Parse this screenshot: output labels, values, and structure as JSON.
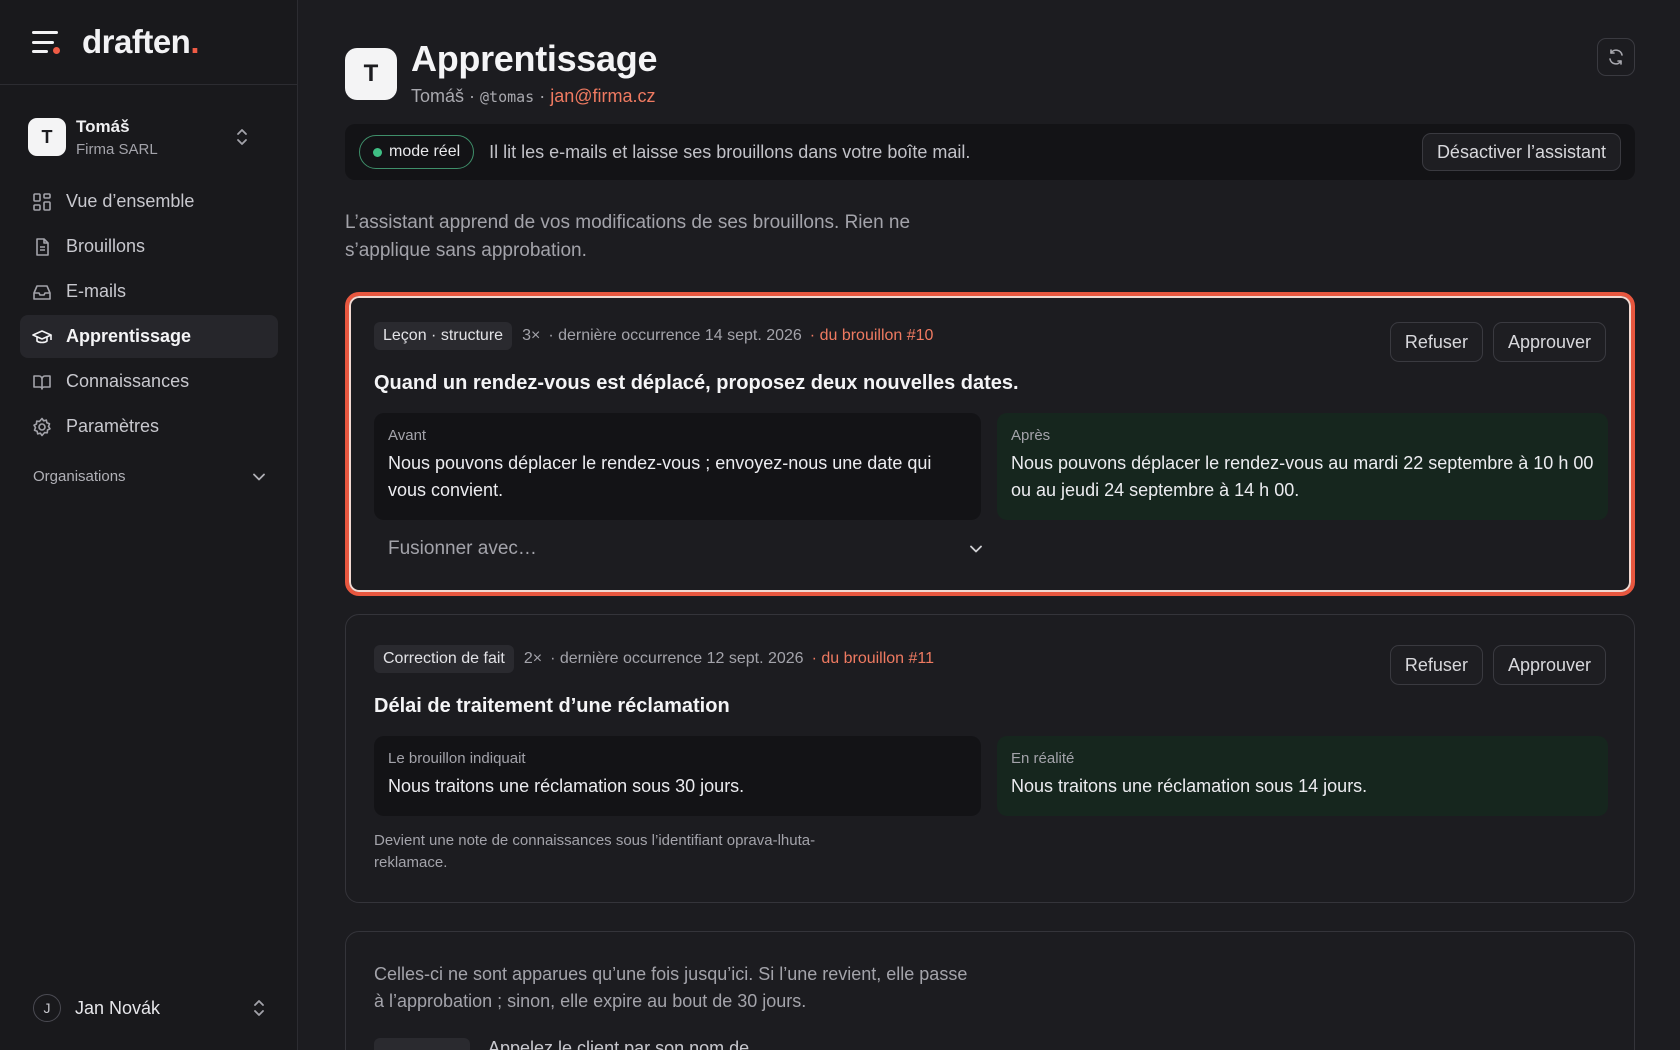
{
  "brand": {
    "name": "draften",
    "dot": "."
  },
  "workspace": {
    "initial": "T",
    "name": "Tomáš",
    "company": "Firma SARL"
  },
  "nav": [
    {
      "label": "Vue d’ensemble",
      "icon": "grid-icon",
      "active": false
    },
    {
      "label": "Brouillons",
      "icon": "document-icon",
      "active": false
    },
    {
      "label": "E-mails",
      "icon": "inbox-icon",
      "active": false
    },
    {
      "label": "Apprentissage",
      "icon": "graduation-cap-icon",
      "active": true
    },
    {
      "label": "Connaissances",
      "icon": "book-icon",
      "active": false
    },
    {
      "label": "Paramètres",
      "icon": "gear-icon",
      "active": false
    }
  ],
  "organizations_label": "Organisations",
  "user": {
    "initial": "J",
    "name": "Jan Novák"
  },
  "header": {
    "initial": "T",
    "title": "Apprentissage",
    "name": "Tomáš",
    "sep": " · ",
    "handle": "@tomas",
    "email": "jan@firma.cz"
  },
  "banner": {
    "mode": "mode réel",
    "text": "Il lit les e-mails et laisse ses brouillons dans votre boîte mail.",
    "disable_label": "Désactiver l’assistant"
  },
  "intro": "L’assistant apprend de vos modifications de ses brouillons. Rien ne s’applique sans approbation.",
  "cards": [
    {
      "tag": "Leçon · structure",
      "count": "3×",
      "occurrence": "· dernière occurrence 14 sept. 2026",
      "source": "· du brouillon #10",
      "title": "Quand un rendez-vous est déplacé, proposez deux nouvelles dates.",
      "before_label": "Avant",
      "before_text": "Nous pouvons déplacer le rendez-vous ; envoyez-nous une date qui vous convient.",
      "after_label": "Après",
      "after_text": "Nous pouvons déplacer le rendez-vous au mardi 22 septembre à 10 h 00 ou au jeudi 24 septembre à 14 h 00.",
      "merge_placeholder": "Fusionner avec…",
      "reject": "Refuser",
      "approve": "Approuver"
    },
    {
      "tag": "Correction de fait",
      "count": "2×",
      "occurrence": "· dernière occurrence 12 sept. 2026",
      "source": "· du brouillon #11",
      "title": "Délai de traitement d’une réclamation",
      "before_label": "Le brouillon indiquait",
      "before_text": "Nous traitons une réclamation sous 30 jours.",
      "after_label": "En réalité",
      "after_text": "Nous traitons une réclamation sous 14 jours.",
      "note": "Devient une note de connaissances sous l’identifiant oprava-lhuta-reklamace.",
      "reject": "Refuser",
      "approve": "Approuver"
    }
  ],
  "pending": {
    "text": "Celles-ci ne sont apparues qu’une fois jusqu’ici. Si l’une revient, elle passe à l’approbation ; sinon, elle expire au bout de 30 jours.",
    "peek": "Appelez le client par son nom de"
  }
}
